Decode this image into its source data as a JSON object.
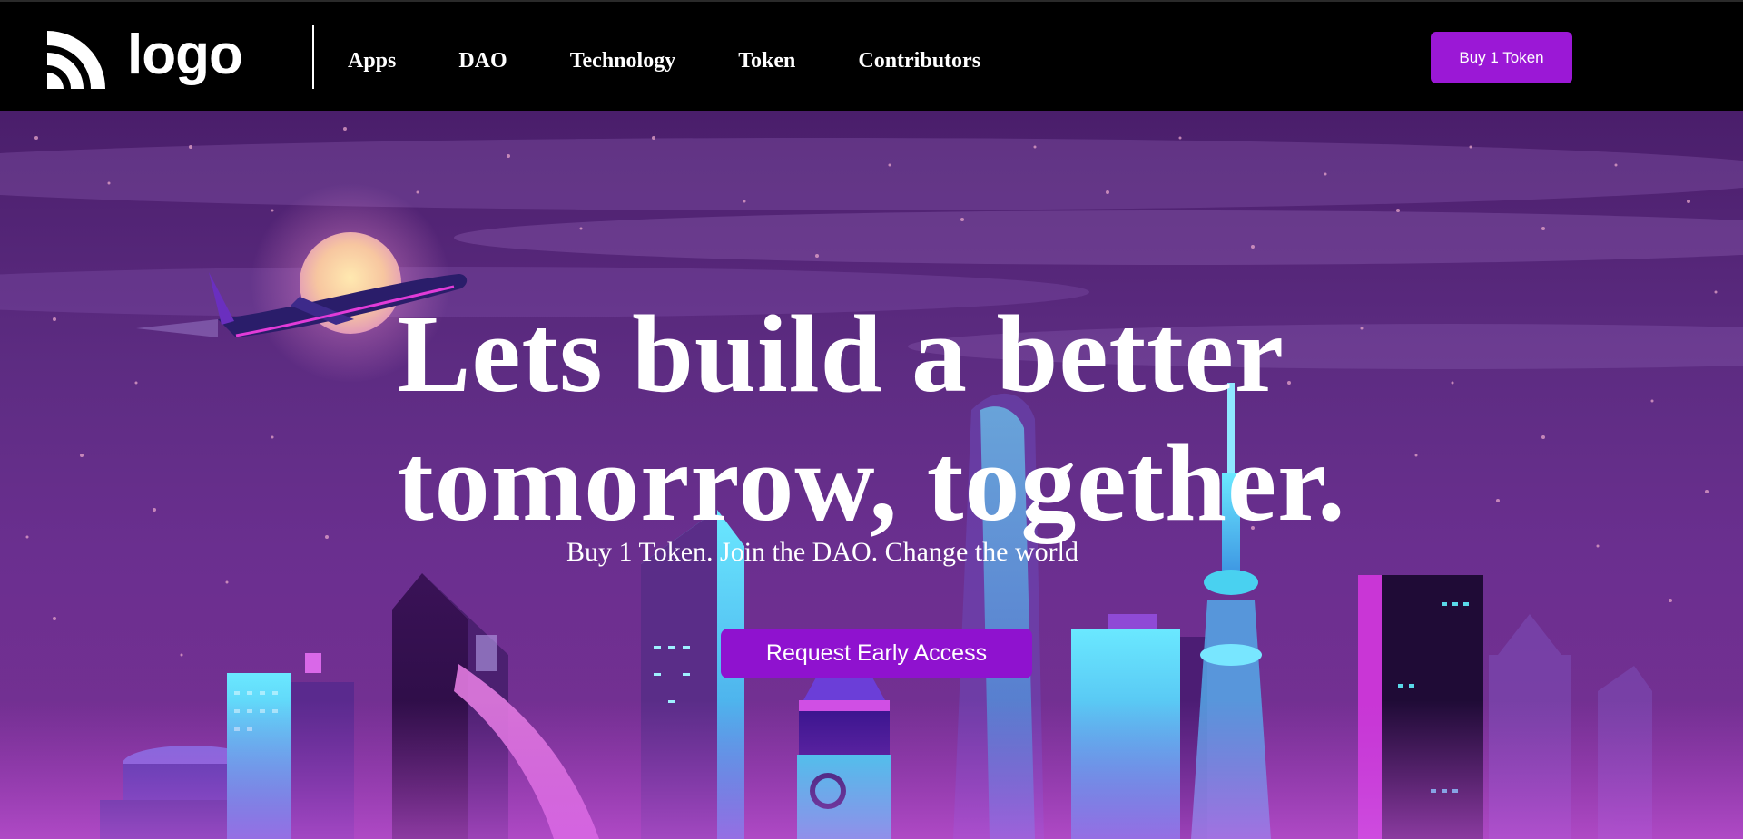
{
  "header": {
    "logo_text": "logo",
    "nav_items": [
      "Apps",
      "DAO",
      "Technology",
      "Token",
      "Contributors"
    ],
    "buy_button": "Buy 1 Token"
  },
  "hero": {
    "title_line1": "Lets build a better",
    "title_line2": "tomorrow, together.",
    "subtitle": "Buy 1 Token. Join the DAO. Change the world",
    "cta_button": "Request Early Access"
  },
  "colors": {
    "nav_background": "#000000",
    "accent_purple": "#9b18d6",
    "cta_purple": "#8f12cf",
    "hero_sky": "#5d2c82",
    "neon_cyan": "#3de3f0",
    "neon_pink": "#e040d8"
  },
  "icons": {
    "logo_mark": "rss-signal-icon"
  }
}
